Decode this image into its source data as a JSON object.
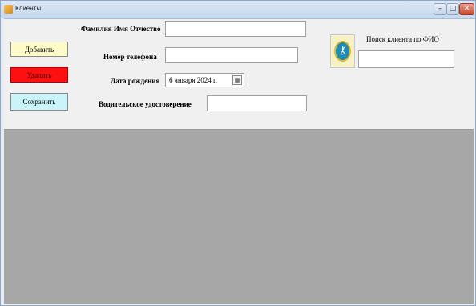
{
  "window": {
    "title": "Клиенты",
    "controls": {
      "minimize": "–",
      "maximize": "□",
      "close": "✕"
    }
  },
  "actions": {
    "add_label": "Добавить",
    "delete_label": "Удалить",
    "save_label": "Сохранить"
  },
  "form": {
    "fio_label": "Фамилия Имя Отчество",
    "fio_value": "",
    "phone_label": "Номер телефона",
    "phone_value": "",
    "birthdate_label": "Дата рождения",
    "birthdate_value": "6 января 2024 г.",
    "license_label": "Водительское удостоверение",
    "license_value": ""
  },
  "search": {
    "label": "Поиск клиента по ФИО",
    "value": ""
  },
  "icons": {
    "logo": "key-logo-icon",
    "calendar": "calendar-icon"
  },
  "colors": {
    "add_button": "#fdfbc8",
    "delete_button": "#ff1010",
    "save_button": "#c9f4f9",
    "grid_area": "#a7a7a7"
  }
}
